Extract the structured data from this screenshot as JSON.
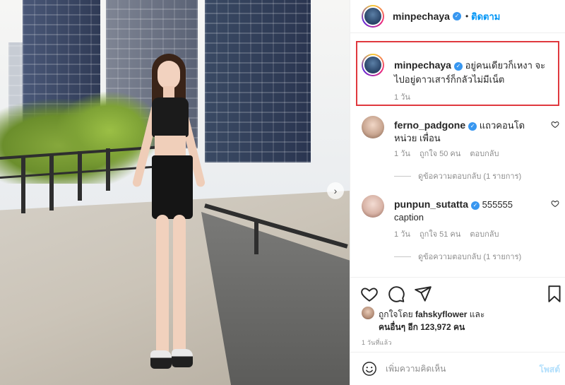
{
  "header": {
    "username": "minpechaya",
    "separator": "•",
    "follow_label": "ติดตาม"
  },
  "caption": {
    "username": "minpechaya",
    "text": "อยู่คนเดียวก็เหงา จะไปอยู่ดาวเสาร์ก็กลัวไม่มีเน็ต",
    "time": "1 วัน"
  },
  "comments": [
    {
      "username": "ferno_padgone",
      "text": "แถวคอนโดหน่วย เพื่อน",
      "time": "1 วัน",
      "likes": "ถูกใจ 50 คน",
      "reply": "ตอบกลับ",
      "view_replies": "ดูข้อความตอบกลับ (1 รายการ)"
    },
    {
      "username": "punpun_sutatta",
      "text": "555555 caption",
      "time": "1 วัน",
      "likes": "ถูกใจ 51 คน",
      "reply": "ตอบกลับ",
      "view_replies": "ดูข้อความตอบกลับ (1 รายการ)"
    }
  ],
  "likes": {
    "liked_by_prefix": "ถูกใจโดย",
    "liked_by_user": "fahskyflower",
    "and": "และ",
    "others_label": "คนอื่นๆ",
    "others_count": "อีก 123,972 คน"
  },
  "posted_time": "1 วันที่แล้ว",
  "add_comment": {
    "placeholder": "เพิ่มความคิดเห็น",
    "post_label": "โพสต์"
  },
  "icons": {
    "verified": "verified-badge-icon",
    "heart": "heart-icon",
    "comment": "comment-icon",
    "share": "share-icon",
    "save": "bookmark-icon",
    "emoji": "emoji-icon",
    "next": "chevron-right-icon"
  },
  "colors": {
    "accent": "#0095f6",
    "highlight_border": "#e0383e",
    "muted": "#8e8e8e"
  }
}
